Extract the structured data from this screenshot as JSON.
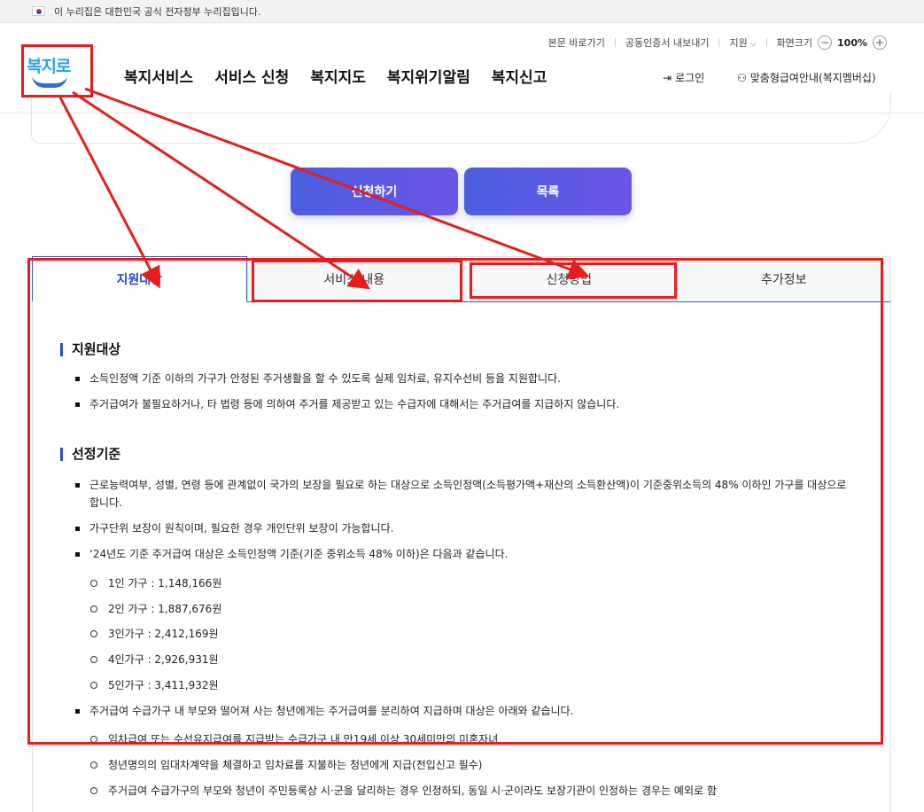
{
  "gov_banner": {
    "text": "이 누리집은 대한민국 공식 전자정부 누리집입니다."
  },
  "utility": {
    "skip": "본문 바로가기",
    "cert": "공동인증서 내보내기",
    "support": "지원",
    "zoom_label": "화면크기",
    "zoom_minus": "−",
    "zoom_value": "100%",
    "zoom_plus": "+"
  },
  "logo": {
    "text": "복지로"
  },
  "nav": {
    "items": [
      "복지서비스",
      "서비스 신청",
      "복지지도",
      "복지위기알림",
      "복지신고"
    ]
  },
  "header_links": {
    "login": "로그인",
    "custom": "맞춤형급여안내(복지멤버십)"
  },
  "actions": {
    "apply": "신청하기",
    "list": "목록"
  },
  "tabs": [
    {
      "label": "지원대상",
      "active": true
    },
    {
      "label": "서비스 내용",
      "active": false
    },
    {
      "label": "신청방법",
      "active": false
    },
    {
      "label": "추가정보",
      "active": false
    }
  ],
  "content": {
    "s1_title": "지원대상",
    "s1_items": [
      "소득인정액 기준 이하의 가구가 안정된 주거생활을 할 수 있도록 실제 임차료, 유지수선비 등을 지원합니다.",
      "주거급여가 불필요하거나, 타 법령 등에 의하여 주거를 제공받고 있는 수급자에 대해서는 주거급여를 지급하지 않습니다."
    ],
    "s2_title": "선정기준",
    "s2_items": [
      "근로능력여부, 성별, 연령 등에 관계없이 국가의 보장을 필요로 하는 대상으로 소득인정액(소득평가액+재산의 소득환산액)이 기준중위소득의 48% 이하인 가구를 대상으로",
      "합니다.",
      "가구단위 보장이 원칙이며, 필요한 경우 개인단위 보장이 가능합니다.",
      "‘24년도 기준 주거급여 대상은 소득인정액 기준(기준 중위소득 48% 이하)은 다음과 같습니다.",
      "주거급여 수급가구 내 부모와 떨어져 사는 청년에게는 주거급여를 분리하여 지급하며 대상은 아래와 같습니다."
    ],
    "s2_sub": [
      "1인 가구 : 1,148,166원",
      "2인 가구 : 1,887,676원",
      "3인가구 : 2,412,169원",
      "4인가구 : 2,926,931원",
      "5인가구 : 3,411,932원"
    ],
    "youth_sub": [
      "임차급여 또는 수선유지급여를 지급받는 수급가구 내 만19세 이상 30세미만의 미혼자녀",
      "청년명의의 임대차계약을 체결하고 임차료를 지불하는 청년에게 지급(전입신고 필수)",
      "주거급여 수급가구의 부모와 청년이 주민등록상 시·군을 달리하는 경우 인정하되, 동일 시·군이라도 보장기관이 인정하는 경우는 예외로 함"
    ]
  },
  "annotation_color": "#e41d1d"
}
